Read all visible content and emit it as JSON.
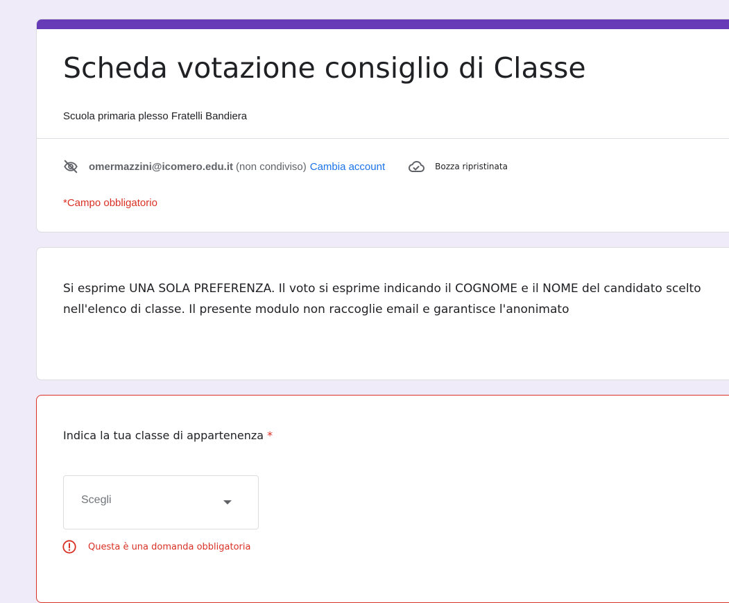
{
  "header": {
    "title": "Scheda votazione consiglio di Classe",
    "subtitle": "Scuola primaria plesso Fratelli Bandiera",
    "account": {
      "email": "omermazzini@icomero.edu.it",
      "status": "(non condiviso)",
      "switch_label": "Cambia account",
      "icon": "eye-off-icon"
    },
    "draft": {
      "icon": "cloud-check-icon",
      "label": "Bozza ripristinata"
    },
    "required_note": "*Campo obbligatorio"
  },
  "description": {
    "text": "Si esprime UNA SOLA PREFERENZA. Il voto si esprime indicando il COGNOME e il NOME del candidato scelto nell'elenco di classe. Il presente modulo non raccoglie email e garantisce l'anonimato"
  },
  "question": {
    "label": "Indica la tua classe di appartenenza",
    "required_marker": "*",
    "select_value": "Scegli",
    "error_text": "Questa è una domanda obbligatoria",
    "error_icon": "error-icon"
  },
  "colors": {
    "accent": "#673ab7",
    "background": "#f0ebf8",
    "error": "#d93025",
    "link": "#1a73e8"
  }
}
